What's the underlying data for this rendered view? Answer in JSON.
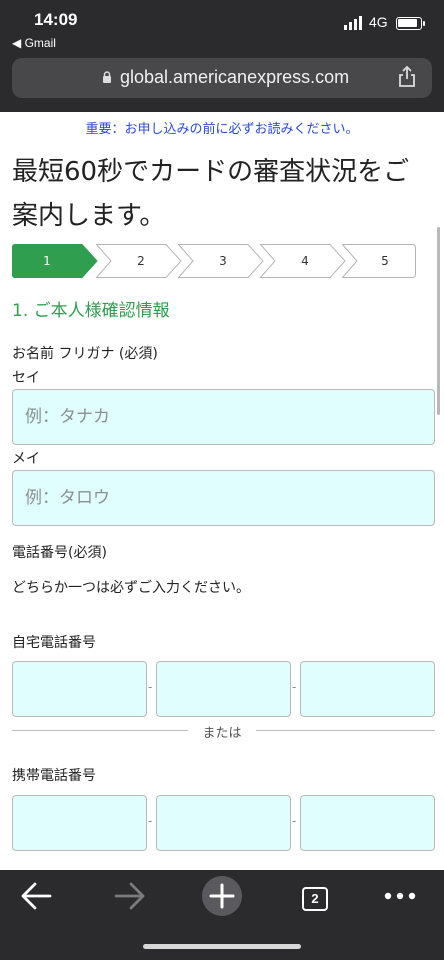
{
  "status_bar": {
    "time": "14:09",
    "back_app": "◀ Gmail",
    "network": "4G"
  },
  "browser": {
    "url": "global.americanexpress.com",
    "tab_count": "2"
  },
  "notice": "重要：お申し込みの前に必ずお読みください。",
  "headline": {
    "line1": "最短60秒でカードの審査状況をご",
    "line2": "案内します。"
  },
  "steps": [
    "1",
    "2",
    "3",
    "4",
    "5"
  ],
  "active_step": "1",
  "section_title": "1. ご本人様確認情報",
  "name_kana": {
    "label": "お名前 フリガナ (必須)",
    "sei_label": "セイ",
    "sei_placeholder": "例：タナカ",
    "mei_label": "メイ",
    "mei_placeholder": "例：タロウ"
  },
  "phone": {
    "label": "電話番号(必須)",
    "instruction": "どちらか一つは必ずご入力ください。",
    "home_label": "自宅電話番号",
    "separator": "-",
    "or_text": "または",
    "mobile_label": "携帯電話番号"
  },
  "colors": {
    "accent_green": "#2f9e4f",
    "notice_blue": "#2b49d6",
    "input_bg": "#e0fefe",
    "chrome": "#2b2b2d"
  },
  "icons": [
    "lock-icon",
    "share-icon",
    "back-arrow-icon",
    "forward-arrow-icon",
    "new-tab-plus-icon",
    "tabs-icon",
    "more-icon"
  ]
}
